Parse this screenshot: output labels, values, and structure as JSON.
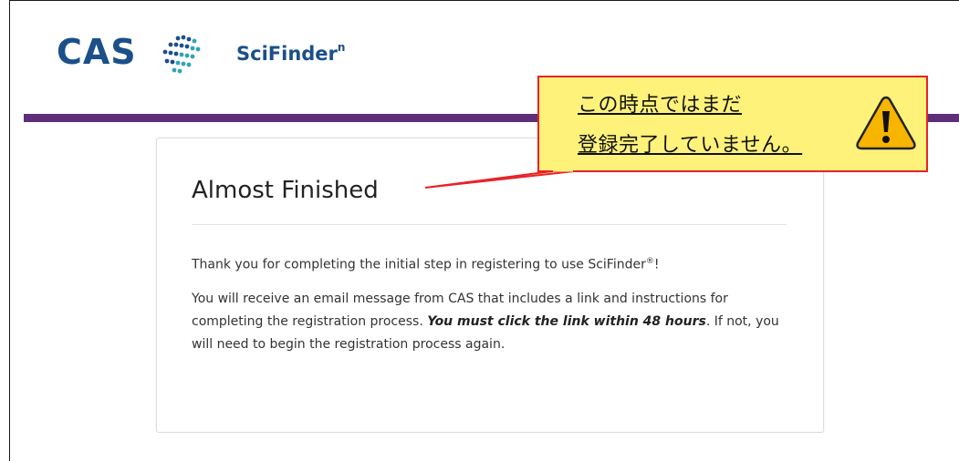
{
  "header": {
    "brand": "CAS",
    "product": "SciFinder",
    "product_superscript": "n"
  },
  "card": {
    "title": "Almost Finished",
    "paragraph1_text": "Thank you for completing the initial step in registering to use SciFinder",
    "paragraph1_registered": "®",
    "paragraph1_end": "!",
    "paragraph2_part1": "You will receive an email message from CAS that includes a link and instructions for completing the registration process. ",
    "paragraph2_emphasis": "You must click the link within 48 hours",
    "paragraph2_part2": ". If not, you will need to begin the registration process again."
  },
  "callout": {
    "line1": "この時点ではまだ",
    "line2": "登録完了していません。",
    "icon": "warning-icon"
  },
  "colors": {
    "brand_blue": "#1b4f8a",
    "brand_teal": "#2fa4b5",
    "purple_bar": "#5e2e79",
    "callout_bg": "#fff27a",
    "callout_border": "#e8222a",
    "warning_fill": "#f7b500"
  }
}
